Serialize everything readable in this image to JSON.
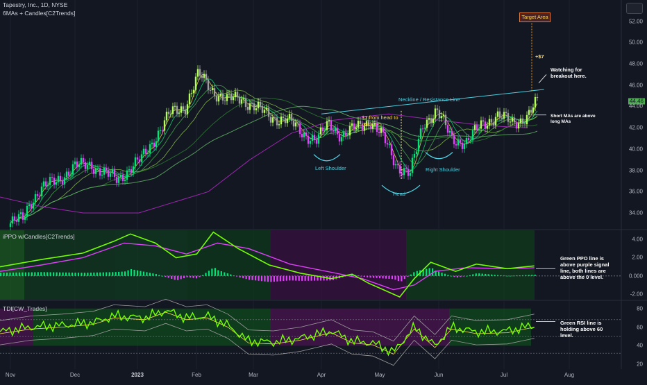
{
  "header": {
    "title": "Tapestry, Inc., 1D, NYSE",
    "indicator": "6MAs + Candles[C2Trends]"
  },
  "panes": {
    "ppo_title": "iPPO w/Candles[C2Trends]",
    "tdi_title": "TDI[CW_Trades]"
  },
  "annotations": {
    "target_area": "Target Area",
    "plus_seven": "+$7",
    "watching": [
      "Watching for",
      "breakout here."
    ],
    "neckline": "Neckline / Resistance Line",
    "seven_from_head": [
      "$7 from head to",
      "neckline"
    ],
    "short_mas": [
      "Short MAs are above",
      "long MAs"
    ],
    "left_shoulder": "Left Shoulder",
    "head": "Head",
    "right_shoulder": "Right Shoulder",
    "ppo_note": [
      "Green  PPO line is",
      "above purple signal",
      "line, both lines are",
      "above the 0 level."
    ],
    "rsi_note": [
      "Green RSI line is",
      "holding above 60",
      "level."
    ]
  },
  "colors": {
    "background": "#131722",
    "green": "#00e676",
    "lime": "#76ff03",
    "magenta": "#e040fb",
    "cyan": "#4dd0e1",
    "orange": "#ff9800"
  },
  "chart_data": [
    {
      "type": "candlestick",
      "title": "Tapestry, Inc., 1D, NYSE",
      "last_price": "44.46",
      "ylim": [
        32.5,
        54
      ],
      "y_ticks": [
        "52.00",
        "50.00",
        "48.00",
        "46.00",
        "44.00",
        "42.00",
        "40.00",
        "38.00",
        "36.00",
        "34.00"
      ],
      "x_ticks": [
        "Nov",
        "Dec",
        "2023",
        "Feb",
        "Mar",
        "Apr",
        "May",
        "Jun",
        "Jul",
        "Aug"
      ],
      "price_path": [
        [
          "Nov 1",
          33.0
        ],
        [
          "Nov 7",
          33.5
        ],
        [
          "Nov 10",
          35.0
        ],
        [
          "Nov 15",
          36.2
        ],
        [
          "Nov 22",
          37.0
        ],
        [
          "Dec 1",
          38.3
        ],
        [
          "Dec 9",
          38.6
        ],
        [
          "Dec 16",
          37.6
        ],
        [
          "Dec 22",
          37.2
        ],
        [
          "Jan 3",
          39.0
        ],
        [
          "Jan 10",
          41.0
        ],
        [
          "Jan 18",
          43.3
        ],
        [
          "Jan 26",
          44.0
        ],
        [
          "Feb 2",
          47.0
        ],
        [
          "Feb 9",
          45.5
        ],
        [
          "Feb 16",
          44.6
        ],
        [
          "Feb 23",
          44.8
        ],
        [
          "Mar 2",
          43.9
        ],
        [
          "Mar 9",
          43.0
        ],
        [
          "Mar 16",
          42.8
        ],
        [
          "Mar 23",
          41.6
        ],
        [
          "Mar 30",
          40.8
        ],
        [
          "Apr 5",
          42.4
        ],
        [
          "Apr 12",
          41.2
        ],
        [
          "Apr 19",
          42.0
        ],
        [
          "Apr 26",
          42.7
        ],
        [
          "May 3",
          41.0
        ],
        [
          "May 10",
          38.5
        ],
        [
          "May 17",
          37.6
        ],
        [
          "May 24",
          42.5
        ],
        [
          "May 31",
          43.6
        ],
        [
          "Jun 7",
          41.0
        ],
        [
          "Jun 14",
          40.6
        ],
        [
          "Jun 21",
          42.4
        ],
        [
          "Jun 28",
          43.1
        ],
        [
          "Jul 5",
          42.5
        ],
        [
          "Jul 12",
          43.0
        ],
        [
          "Jul 17",
          44.46
        ]
      ],
      "neckline": {
        "start": [
          "Apr 1",
          43.3
        ],
        "end": [
          "Jul 20",
          45.6
        ]
      },
      "target": 52.6
    },
    {
      "type": "line",
      "title": "iPPO w/Candles[C2Trends]",
      "ylim": [
        -2.6,
        5.0
      ],
      "y_ticks": [
        "4.00",
        "2.00",
        "0.000",
        "-2.00"
      ],
      "series": [
        {
          "values": [
            [
              0,
              1.0
            ],
            [
              20,
              1.8
            ],
            [
              40,
              2.5
            ],
            [
              55,
              3.8
            ],
            [
              63,
              4.6
            ],
            [
              75,
              3.6
            ],
            [
              85,
              2.0
            ],
            [
              95,
              2.4
            ],
            [
              103,
              4.8
            ],
            [
              115,
              3.0
            ],
            [
              130,
              1.2
            ],
            [
              145,
              0.3
            ],
            [
              160,
              -0.3
            ],
            [
              170,
              0.2
            ],
            [
              178,
              -0.8
            ],
            [
              185,
              -1.5
            ],
            [
              193,
              -2.3
            ],
            [
              200,
              -0.3
            ],
            [
              208,
              1.5
            ],
            [
              220,
              0.5
            ],
            [
              230,
              1.3
            ],
            [
              245,
              0.8
            ],
            [
              258,
              1.1
            ]
          ]
        },
        {
          "values": [
            [
              0,
              0.5
            ],
            [
              20,
              1.2
            ],
            [
              40,
              2.0
            ],
            [
              60,
              3.6
            ],
            [
              75,
              3.3
            ],
            [
              90,
              2.4
            ],
            [
              105,
              3.6
            ],
            [
              120,
              3.0
            ],
            [
              140,
              1.3
            ],
            [
              160,
              0.4
            ],
            [
              175,
              -0.3
            ],
            [
              190,
              -1.5
            ],
            [
              200,
              -1.0
            ],
            [
              210,
              0.5
            ],
            [
              225,
              0.9
            ],
            [
              245,
              0.8
            ],
            [
              258,
              0.9
            ]
          ]
        }
      ]
    },
    {
      "type": "line",
      "title": "TDI[CW_Trades]",
      "ylim": [
        15,
        88
      ],
      "y_ticks": [
        "80",
        "60",
        "40",
        "20"
      ],
      "series": [
        {
          "values": [
            [
              0,
              55
            ],
            [
              15,
              60
            ],
            [
              30,
              62
            ],
            [
              45,
              65
            ],
            [
              55,
              72
            ],
            [
              70,
              70
            ],
            [
              80,
              78
            ],
            [
              90,
              70
            ],
            [
              100,
              72
            ],
            [
              110,
              62
            ],
            [
              120,
              45
            ],
            [
              132,
              44
            ],
            [
              145,
              48
            ],
            [
              160,
              56
            ],
            [
              170,
              45
            ],
            [
              180,
              43
            ],
            [
              190,
              33
            ],
            [
              200,
              60
            ],
            [
              210,
              40
            ],
            [
              218,
              60
            ],
            [
              230,
              55
            ],
            [
              245,
              56
            ],
            [
              258,
              62
            ]
          ]
        }
      ]
    }
  ]
}
